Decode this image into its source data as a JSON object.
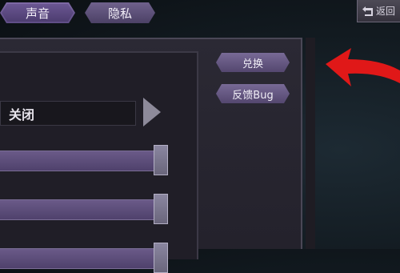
{
  "tabs": [
    {
      "label": "声音",
      "active": true
    },
    {
      "label": "隐私",
      "active": false
    }
  ],
  "back_button": {
    "label": "返回"
  },
  "settings": {
    "option_value": "关闭",
    "sliders": [
      {
        "fill_fraction": 0.95
      },
      {
        "fill_fraction": 0.95
      },
      {
        "fill_fraction": 0.95
      }
    ]
  },
  "side_buttons": {
    "redeem_label": "兑换",
    "feedback_label": "反馈Bug"
  },
  "colors": {
    "accent": "#6a5692",
    "hint_arrow": "#e01818"
  }
}
